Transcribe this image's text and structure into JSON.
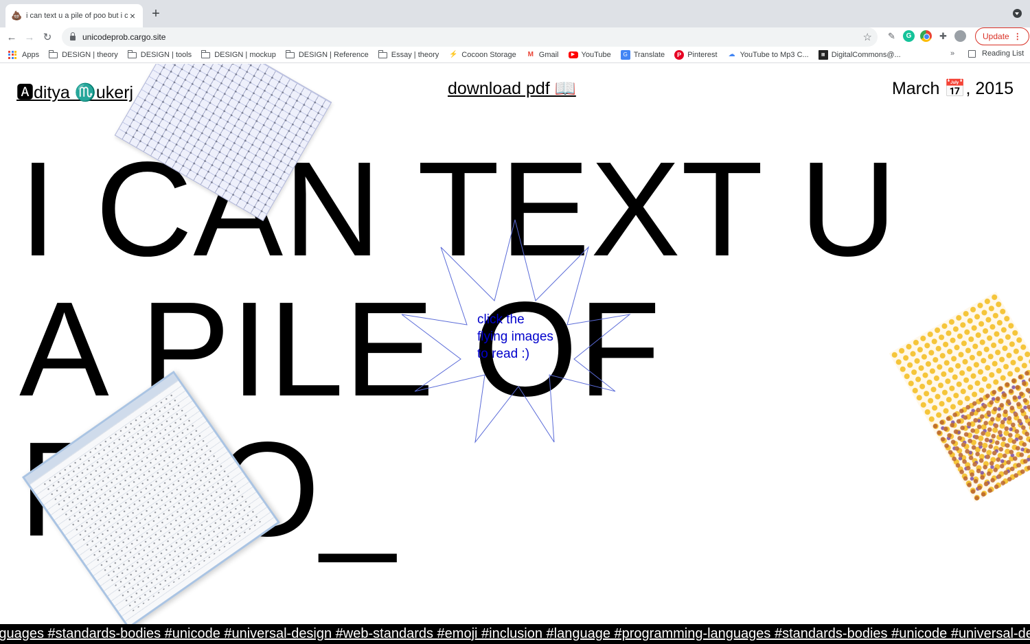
{
  "browser": {
    "tab_favicon": "💩",
    "tab_title": "i can text u a pile of poo but i c",
    "new_tab_label": "+",
    "url": "unicodeprob.cargo.site",
    "update_label": "Update",
    "icons": [
      "back-arrow-icon",
      "forward-arrow-icon",
      "reload-icon",
      "lock-icon",
      "star-icon",
      "extensions-icon",
      "profile-icon"
    ]
  },
  "bookmarks": {
    "items": [
      {
        "label": "Apps",
        "icon": "apps-grid-icon"
      },
      {
        "label": "DESIGN | theory",
        "icon": "folder-icon"
      },
      {
        "label": "DESIGN | tools",
        "icon": "folder-icon"
      },
      {
        "label": "DESIGN | mockup",
        "icon": "folder-icon"
      },
      {
        "label": "DESIGN | Reference",
        "icon": "folder-icon"
      },
      {
        "label": "Essay | theory",
        "icon": "folder-icon"
      },
      {
        "label": "Cocoon Storage",
        "icon": "bolt-icon"
      },
      {
        "label": "Gmail",
        "icon": "gmail-icon"
      },
      {
        "label": "YouTube",
        "icon": "youtube-icon"
      },
      {
        "label": "Translate",
        "icon": "translate-icon"
      },
      {
        "label": "Pinterest",
        "icon": "pinterest-icon"
      },
      {
        "label": "YouTube to Mp3 C...",
        "icon": "download-cloud-icon"
      },
      {
        "label": "DigitalCommons@...",
        "icon": "site-icon"
      }
    ],
    "more": "»",
    "reading_list": "Reading List"
  },
  "page": {
    "author": "🅰ditya ♏ukerj",
    "download": "download pdf 📖",
    "date": "March 📅, 2015",
    "headline_lines": [
      "I CAN TEXT U",
      "A PILE OF",
      "POO_"
    ],
    "starburst_text": [
      "click the",
      "flying images",
      "to read :)"
    ],
    "starburst_color": "#0000cc",
    "hashtags": "-languages #standards-bodies #unicode #universal-design #web-standards #emoji #inclusion #language #programming-languages #standards-bodies #unicode #universal-design #web-standards"
  },
  "colors": {
    "chrome_bg": "#dee1e6",
    "update_red": "#d93025",
    "marquee_bg": "#000000"
  }
}
